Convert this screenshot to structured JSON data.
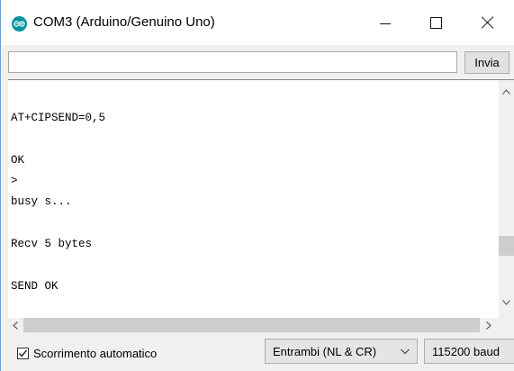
{
  "window": {
    "title": "COM3 (Arduino/Genuino Uno)",
    "icon": "arduino-icon",
    "controls": [
      "minimize-icon",
      "maximize-icon",
      "close-icon"
    ]
  },
  "send": {
    "input_value": "",
    "button_label": "Invia"
  },
  "output": {
    "text": "\nAT+CIPSEND=0,5\n\nOK\n>\nbusy s...\n\nRecv 5 bytes\n\nSEND OK"
  },
  "footer": {
    "autoscroll_label": "Scorrimento automatico",
    "autoscroll_checked": true,
    "line_ending_selected": "Entrambi (NL & CR)",
    "baud_selected": "115200 baud"
  },
  "colors": {
    "arduino_teal": "#00979c",
    "scrollbar_thumb": "#cdcdcd",
    "chrome_bg": "#f0f0f0"
  }
}
